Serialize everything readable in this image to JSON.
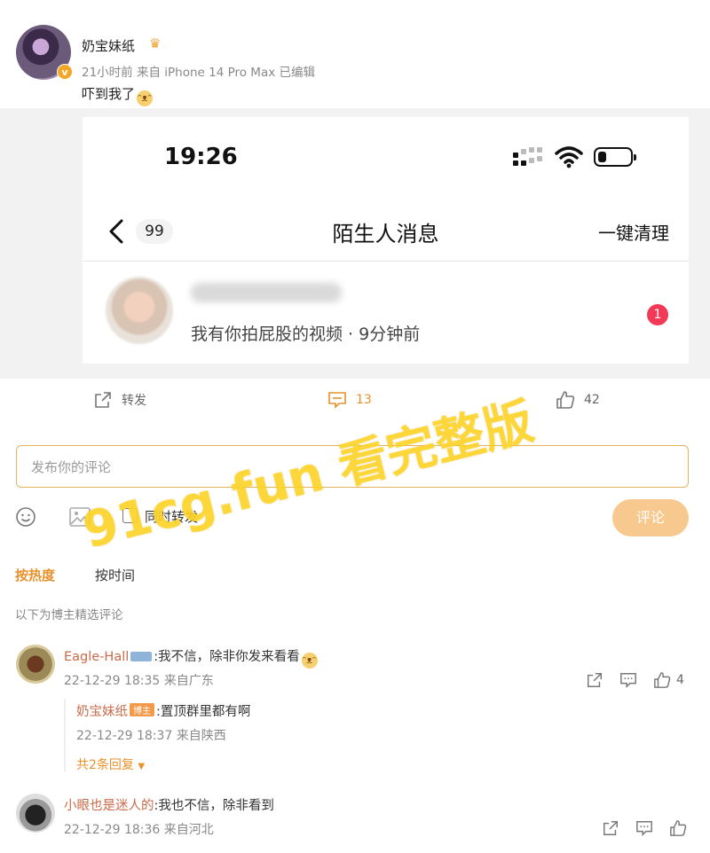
{
  "post": {
    "author": "奶宝妹纸",
    "meta": "21小时前 来自 iPhone 14 Pro Max 已编辑",
    "text": "吓到我了",
    "verified_badge": "v"
  },
  "screenshot": {
    "time": "19:26",
    "back_count": "99",
    "title": "陌生人消息",
    "clear_label": "一键清理",
    "message_preview": "我有你拍屁股的视频 · 9分钟前",
    "unread_count": "1"
  },
  "actions": {
    "repost_label": "转发",
    "comment_count": "13",
    "like_count": "42"
  },
  "composer": {
    "placeholder": "发布你的评论",
    "repost_check_label": "同时转发",
    "submit_label": "评论"
  },
  "sort": {
    "hot": "按热度",
    "time": "按时间"
  },
  "curated_label": "以下为博主精选评论",
  "comments": [
    {
      "user": "Eagle-Hall",
      "badge": "",
      "text": ":我不信，除非你发来看看",
      "meta": "22-12-29 18:35 来自广东",
      "likes": "4",
      "reply": {
        "user": "奶宝妹纸",
        "badge": "博主",
        "text": ":置顶群里都有啊",
        "meta": "22-12-29 18:37 来自陕西"
      },
      "more_replies": "共2条回复"
    },
    {
      "user": "小眼也是迷人的",
      "text": ":我也不信，除非看到",
      "meta": "22-12-29 18:36 来自河北"
    }
  ],
  "watermark": "91cg.fun 看完整版",
  "colors": {
    "accent": "#e8912a",
    "badge_red": "#f23a56",
    "watermark": "#ffd628"
  }
}
